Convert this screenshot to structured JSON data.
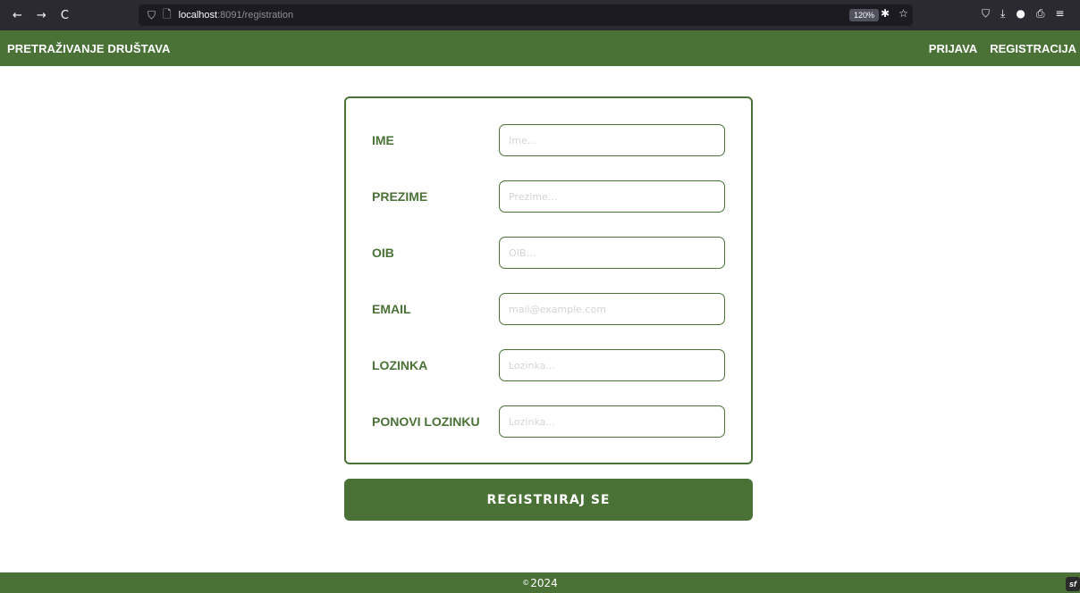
{
  "browser": {
    "back_icon": "←",
    "forward_icon": "→",
    "reload_icon": "C",
    "shield_icon": "⛉",
    "page_icon": "🗋",
    "url_host": "localhost",
    "url_path": ":8091/registration",
    "zoom": "120%",
    "bug_icon": "✱",
    "star_icon": "☆",
    "pocket_icon": "⛉",
    "download_icon": "⤓",
    "account_icon": "●",
    "share_icon": "⎙",
    "menu_icon": "≡"
  },
  "header": {
    "brand": "PRETRAŽIVANJE DRUŠTAVA",
    "nav": [
      {
        "label": "PRIJAVA"
      },
      {
        "label": "REGISTRACIJA"
      }
    ]
  },
  "form": {
    "fields": [
      {
        "label": "IME",
        "placeholder": "Ime..."
      },
      {
        "label": "PREZIME",
        "placeholder": "Prezime..."
      },
      {
        "label": "OIB",
        "placeholder": "OIB..."
      },
      {
        "label": "EMAIL",
        "placeholder": "mail@example.com"
      },
      {
        "label": "LOZINKA",
        "placeholder": "Lozinka..."
      },
      {
        "label": "PONOVI LOZINKU",
        "placeholder": "Lozinka..."
      }
    ],
    "submit_label": "REGISTRIRAJ SE"
  },
  "footer": {
    "copyright_symbol": "©",
    "year": "2024",
    "badge": "sf"
  },
  "colors": {
    "brand_green": "#4a7237",
    "browser_dark": "#2b2a33"
  }
}
